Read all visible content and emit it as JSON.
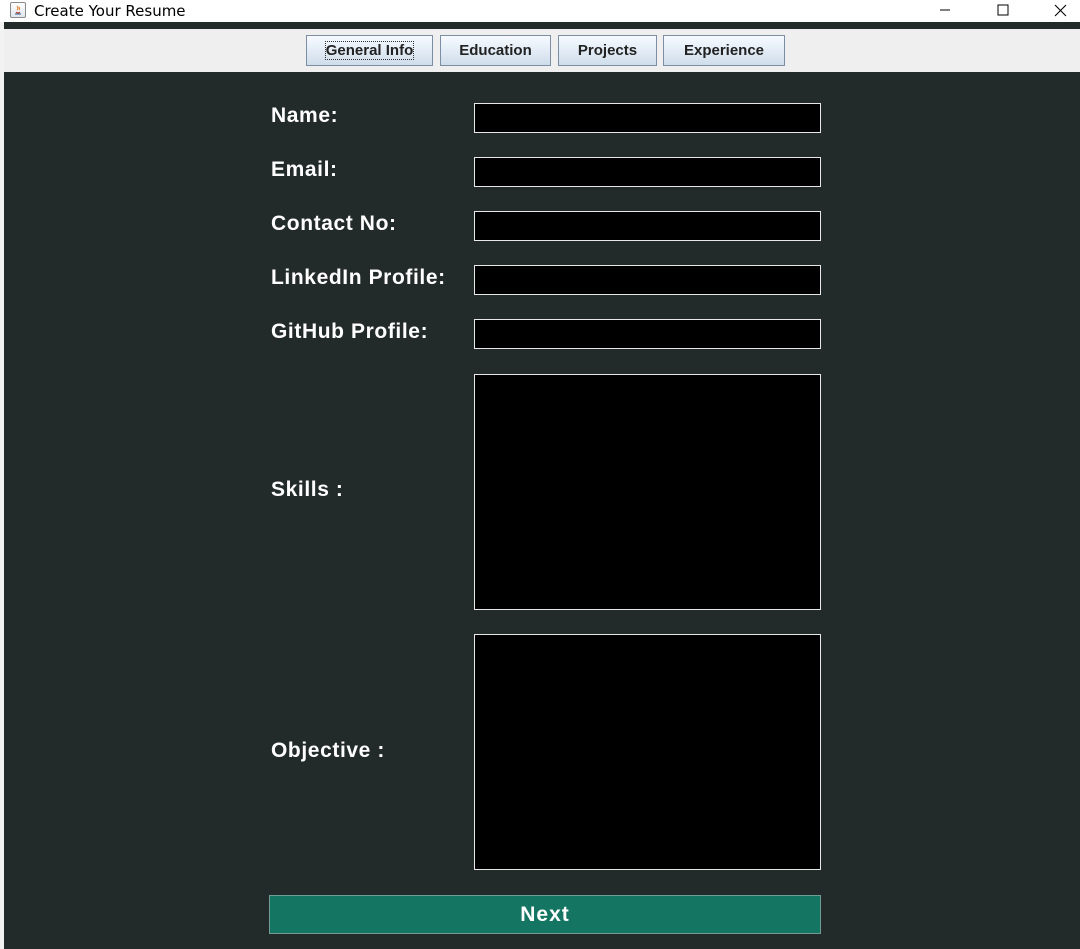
{
  "window": {
    "title": "Create Your Resume",
    "icon": "java-app-icon",
    "controls": {
      "minimize_icon": "minimize-icon",
      "maximize_icon": "maximize-icon",
      "close_icon": "close-icon"
    }
  },
  "tabs": [
    {
      "label": "General Info",
      "focused": true
    },
    {
      "label": "Education"
    },
    {
      "label": "Projects"
    },
    {
      "label": "Experience"
    }
  ],
  "form": {
    "name": {
      "label": "Name:",
      "value": ""
    },
    "email": {
      "label": "Email:",
      "value": ""
    },
    "contact": {
      "label": "Contact No:",
      "value": ""
    },
    "linkedin": {
      "label": "LinkedIn Profile:",
      "value": ""
    },
    "github": {
      "label": "GitHub Profile:",
      "value": ""
    },
    "skills": {
      "label": "Skills :",
      "value": ""
    },
    "objective": {
      "label": "Objective :",
      "value": ""
    }
  },
  "next_button": {
    "label": "Next"
  },
  "colors": {
    "background": "#232a2a",
    "field_background": "#000000",
    "next_button": "#137562",
    "label_text": "#ffffff"
  }
}
